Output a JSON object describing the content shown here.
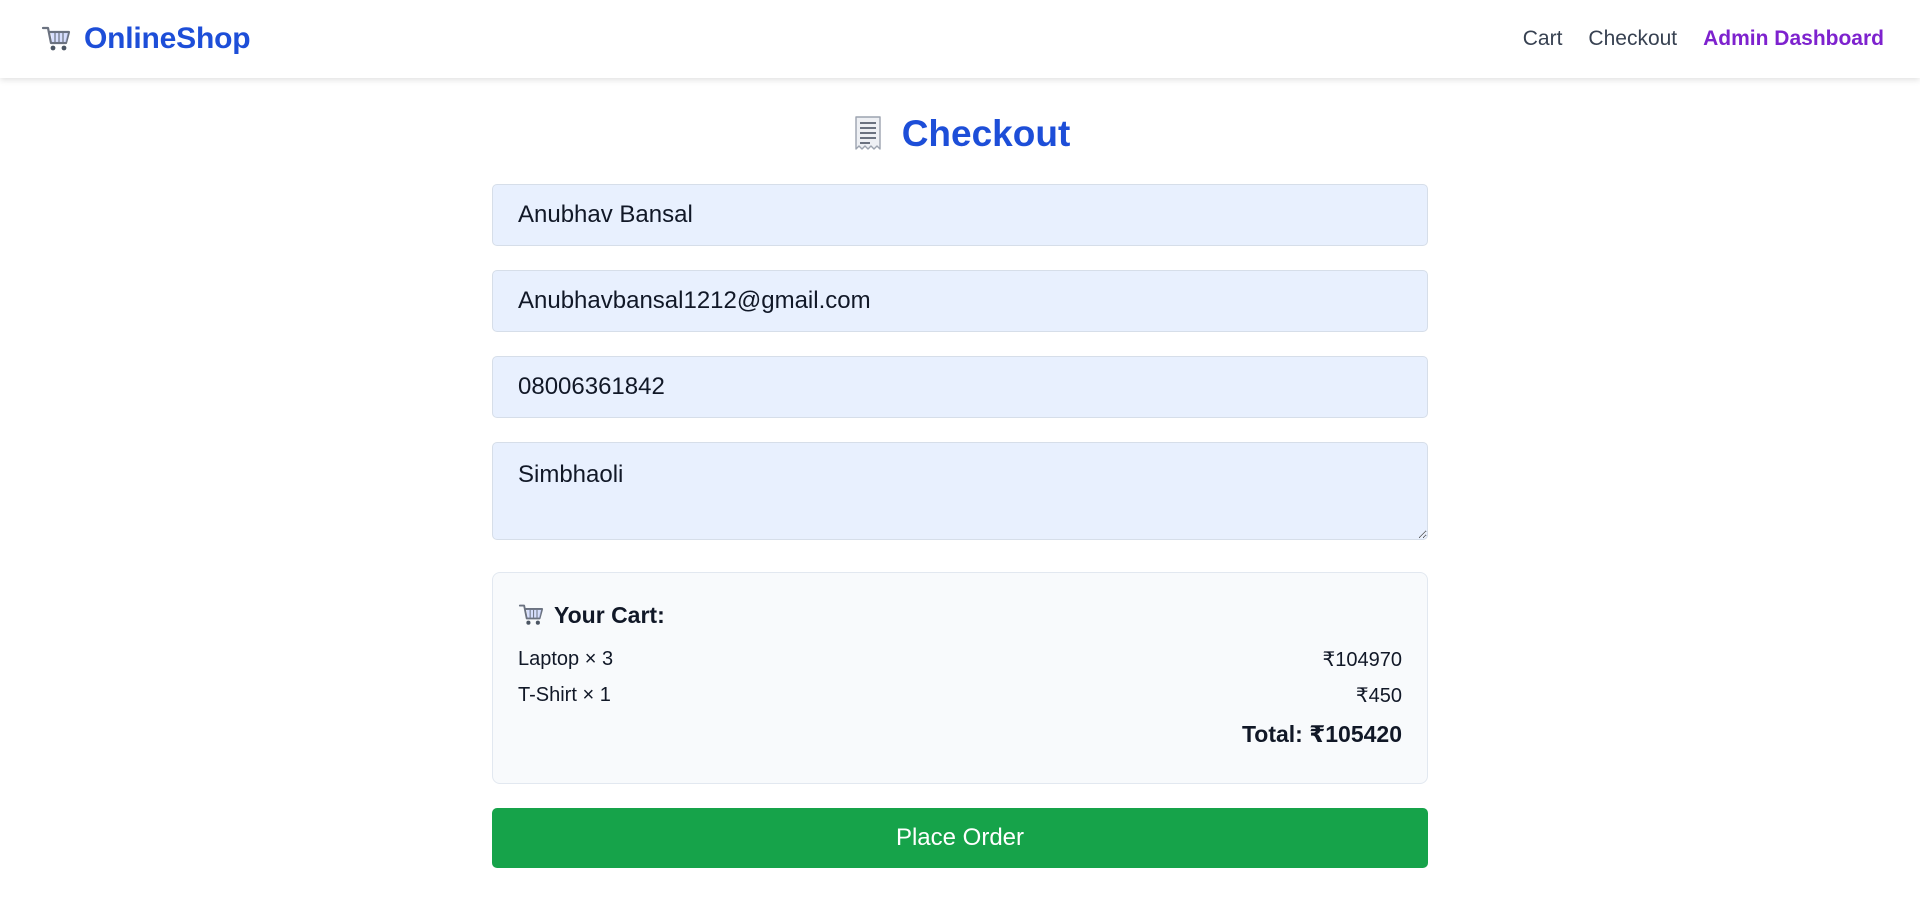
{
  "nav": {
    "brand": "OnlineShop",
    "brand_icon": "cart-icon",
    "links": [
      {
        "label": "Cart"
      },
      {
        "label": "Checkout"
      },
      {
        "label": "Admin Dashboard"
      }
    ]
  },
  "checkout": {
    "title": "Checkout",
    "title_icon": "receipt-icon",
    "fields": {
      "name": "Anubhav Bansal",
      "email": "Anubhavbansal1212@gmail.com",
      "phone": "08006361842",
      "address": "Simbhaoli"
    }
  },
  "cart": {
    "heading": "Your Cart:",
    "heading_icon": "cart-icon",
    "items": [
      {
        "label": "Laptop × 3",
        "price": "₹104970"
      },
      {
        "label": "T-Shirt × 1",
        "price": "₹450"
      }
    ],
    "total": "Total: ₹105420"
  },
  "actions": {
    "place_order": "Place Order"
  },
  "colors": {
    "brand": "#1d4ed8",
    "admin_link": "#7e22ce",
    "input_bg": "#e8f0fe",
    "place_order_bg": "#16a34a"
  }
}
